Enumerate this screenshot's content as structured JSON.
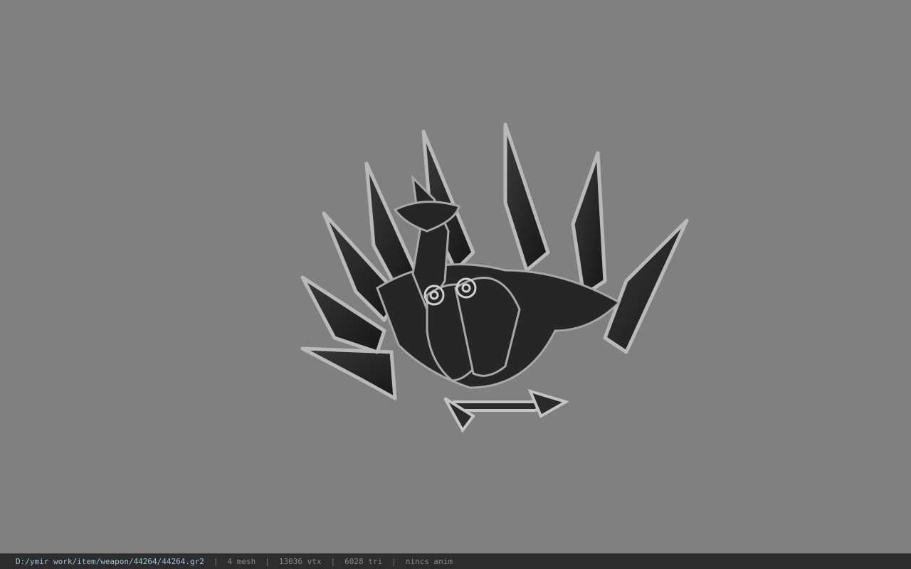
{
  "viewer": {
    "background_color": "#808080",
    "model_icon": "spiked-fan-weapon-model"
  },
  "status": {
    "path": "D:/ymir work/item/weapon/44264/44264.gr2",
    "separator": "|",
    "mesh": "4 mesh",
    "vtx": "13036 vtx",
    "tri": "6028 tri",
    "anim": "nincs anim",
    "path_color": "#9fc3da",
    "text_color": "#8a8a8a"
  }
}
